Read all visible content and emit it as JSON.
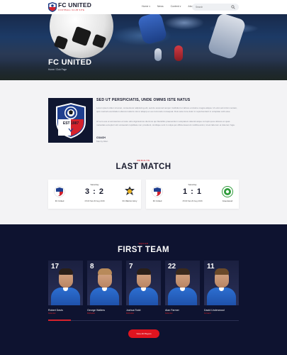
{
  "header": {
    "brand_name": "FC UNITED",
    "brand_tagline": "FOOTBALL CLUB SITE",
    "nav": [
      "Home",
      "News",
      "Content",
      "About Us"
    ],
    "search_placeholder": "Search"
  },
  "hero": {
    "title": "FC UNITED",
    "breadcrumb": "Home / Club Page"
  },
  "about": {
    "heading": "SED UT PERSPICIATIS, UNDE OMNIS ISTE NATUS",
    "paragraph_1": "Lorem ipsum dolor sit amet, consectetur adipiscing elit, sed do eiusmod tempor incididunt ut labore et dolore magna aliqua. Ut enim ad minim veniam, quis nostrud exercitation ullamco laboris nisi ut aliquip ex ea commodo consequat. Duis aute irure dolor in reprehenderit in voluptate velit esse.",
    "paragraph_2": "At vero eos et accusamus et iusto odio dignissimos ducimus qui blanditiis praesentium voluptatum deleniti atque corrupti quos dolores et quas molestias excepturi sint occaecati cupiditate non provident, similique sunt in culpa qui officia deserunt mollitia animi, id est laborum et dolorum fuga.",
    "crest_year": "EST 1987",
    "signature_name": "COACH",
    "signature_role": "Manny Allen"
  },
  "last_match": {
    "kicker": "RESULTS",
    "title": "LAST MATCH",
    "cards": [
      {
        "league": "Saturday",
        "score": "3 : 2",
        "date": "15:00 Sat 20 Aug 2016",
        "home": "FC United",
        "away": "FC Warrior Army"
      },
      {
        "league": "Saturday",
        "score": "1 : 1",
        "date": "15:00 Sat 20 Aug 2016",
        "home": "FC United",
        "away": "Greenwood"
      }
    ]
  },
  "first_team": {
    "kicker": "SQUAD",
    "title": "FIRST TEAM",
    "players": [
      {
        "number": "17",
        "name": "Robert Davis",
        "position": "Defender"
      },
      {
        "number": "8",
        "name": "George Walters",
        "position": "Midfielder"
      },
      {
        "number": "7",
        "name": "Joshua Todd",
        "position": "Midfielder"
      },
      {
        "number": "22",
        "name": "Alan Farmer",
        "position": "Defender"
      },
      {
        "number": "11",
        "name": "David Underwood",
        "position": "Forward"
      }
    ],
    "cta": "View All Players"
  },
  "colors": {
    "accent_red": "#d5222c",
    "navy": "#0e1330",
    "kit_blue": "#2d6fd1"
  }
}
